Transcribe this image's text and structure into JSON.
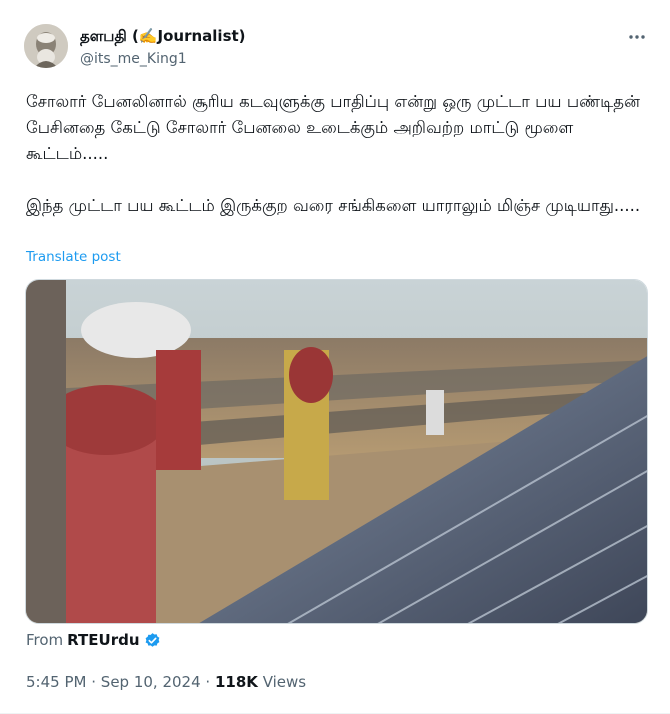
{
  "tweet": {
    "display_name": "தளபதி (",
    "display_name_emoji": "✍️",
    "display_name_suffix": "Journalist)",
    "handle": "@its_me_King1",
    "more_icon": "more-horizontal-icon",
    "paragraph1": "சோலார் பேனலினால் சூரிய கடவுளுக்கு பாதிப்பு என்று ஒரு முட்டா பய பண்டிதன் பேசினதை கேட்டு சோலார் பேனலை உடைக்கும் அறிவற்ற மாட்டு மூளை கூட்டம்.....",
    "paragraph2": "இந்த முட்டா பய கூட்டம் இருக்குற வரை சங்கிகளை யாராலும் மிஞ்ச முடியாது.....",
    "translate_label": "Translate post",
    "from_prefix": "From",
    "from_account": "RTEUrdu",
    "time": "5:45 PM",
    "separator": "·",
    "date": "Sep 10, 2024",
    "views_count": "118K",
    "views_label": "Views"
  },
  "colors": {
    "accent": "#1d9bf0",
    "secondary_text": "#536471"
  }
}
